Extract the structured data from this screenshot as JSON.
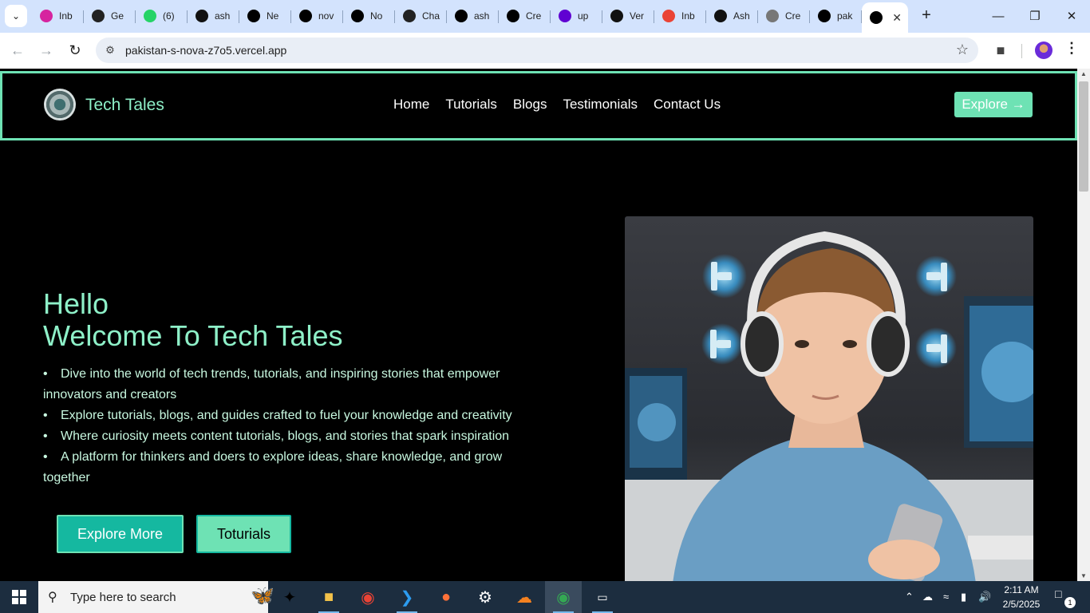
{
  "browser": {
    "tabs": [
      {
        "label": "Inb",
        "icon": "instagram-icon",
        "color": "#d6249f"
      },
      {
        "label": "Ge",
        "icon": "chatgpt-icon",
        "color": "#222"
      },
      {
        "label": "(6)",
        "icon": "whatsapp-icon",
        "color": "#25d366"
      },
      {
        "label": "ash",
        "icon": "github-icon",
        "color": "#111"
      },
      {
        "label": "Ne",
        "icon": "vercel-icon",
        "color": "#000"
      },
      {
        "label": "nov",
        "icon": "vercel-icon",
        "color": "#000"
      },
      {
        "label": "No",
        "icon": "vercel-icon",
        "color": "#000"
      },
      {
        "label": "Cha",
        "icon": "chatgpt-icon",
        "color": "#222"
      },
      {
        "label": "ash",
        "icon": "vercel-icon",
        "color": "#000"
      },
      {
        "label": "Cre",
        "icon": "vercel-icon",
        "color": "#000"
      },
      {
        "label": "up",
        "icon": "yahoo-icon",
        "color": "#6001d2"
      },
      {
        "label": "Ver",
        "icon": "upwork-icon",
        "color": "#111"
      },
      {
        "label": "Inb",
        "icon": "gmail-icon",
        "color": "#ea4335"
      },
      {
        "label": "Ash",
        "icon": "upwork-icon",
        "color": "#111"
      },
      {
        "label": "Cre",
        "icon": "globe-icon",
        "color": "#777"
      },
      {
        "label": "pak",
        "icon": "vercel-icon",
        "color": "#000"
      }
    ],
    "active_tab_icon": "vercel-icon",
    "url": "pakistan-s-nova-z7o5.vercel.app"
  },
  "site": {
    "brand": "Tech Tales",
    "nav": [
      "Home",
      "Tutorials",
      "Blogs",
      "Testimonials",
      "Contact Us"
    ],
    "explore_label": "Explore →",
    "hero_line1": "Hello",
    "hero_line2": "Welcome To Tech Tales",
    "bullets": [
      "Dive into the world of tech trends, tutorials, and inspiring stories that empower innovators and creators",
      "Explore tutorials, blogs, and guides crafted to fuel your knowledge and creativity",
      "Where curiosity meets content tutorials, blogs, and stories that spark inspiration",
      "A platform for thinkers and doers to explore ideas, share knowledge, and grow together"
    ],
    "btn_explore_more": "Explore More",
    "btn_tutorials": "Toturials",
    "colors": {
      "accent": "#6ee2b4",
      "teal": "#15b8a0",
      "background": "#000000"
    }
  },
  "taskbar": {
    "search_placeholder": "Type here to search",
    "time": "2:11 AM",
    "date": "2/5/2025",
    "notification_count": "1"
  }
}
